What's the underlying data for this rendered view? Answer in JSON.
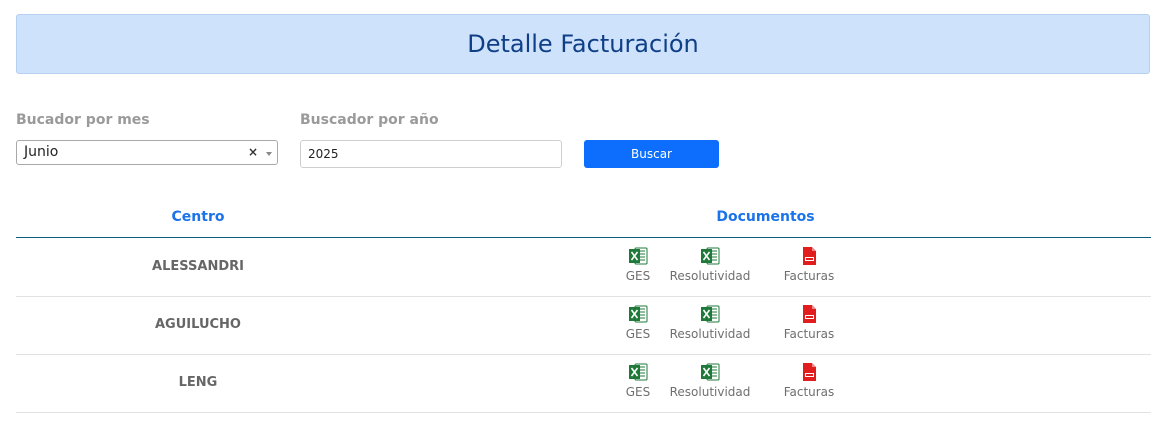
{
  "page": {
    "title": "Detalle Facturación"
  },
  "filters": {
    "month_label": "Bucador por mes",
    "month_value": "Junio",
    "month_clear": "×",
    "year_label": "Buscador por año",
    "year_value": "2025",
    "search_button": "Buscar"
  },
  "table": {
    "headers": [
      "Centro",
      "Documentos"
    ],
    "rows": [
      {
        "centro": "ALESSANDRI",
        "docs": [
          "GES",
          "Resolutividad",
          "Facturas"
        ]
      },
      {
        "centro": "AGUILUCHO",
        "docs": [
          "GES",
          "Resolutividad",
          "Facturas"
        ]
      },
      {
        "centro": "LENG",
        "docs": [
          "GES",
          "Resolutividad",
          "Facturas"
        ]
      }
    ]
  },
  "icons": {
    "excel": "excel-icon",
    "pdf": "pdf-icon",
    "excel_color": "#1f7a3a",
    "pdf_color": "#e11d1d",
    "pdf_text": "PDF",
    "excel_text": "X"
  },
  "colors": {
    "header_bg": "#cfe2fb",
    "accent": "#0d6efd"
  }
}
